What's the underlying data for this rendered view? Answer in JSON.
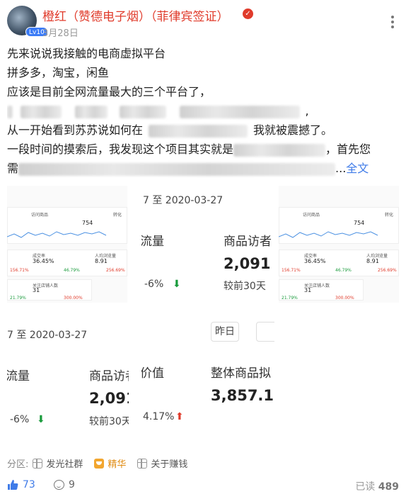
{
  "post": {
    "author": "橙红（赞德电子烟）（菲律宾签证）",
    "avatar_badge": "Lv10",
    "date": "3月28日",
    "lines": [
      "先来说说我接触的电商虚拟平台",
      "拼多多，淘宝，闲鱼",
      "应该是目前全网流量最大的三个平台了，"
    ],
    "line5_prefix": "从一开始看到苏苏说如何在",
    "line5_suffix": "我就被震撼了。",
    "line6_prefix": "一段时间的摸索后，我发现这个项目其实就是",
    "line6_suffix": "，首先您",
    "line7_prefix": "需",
    "ellipsis": "...",
    "full_text_link": "全文"
  },
  "images": {
    "date_range": "7 至 2020-03-27",
    "flow_label": "流量",
    "visit_label": "商品访者",
    "visit_value": "2,091",
    "compare_label": "较前30天",
    "flow_change": "-6%",
    "yesterday_btn": "昨日",
    "value_label": "价值",
    "overall_label": "整体商品拟",
    "overall_value": "3,857.1",
    "overall_change": "4.17%",
    "thumb": {
      "visit_title": "访问商品",
      "spark_value": "754",
      "conv_title": "转化",
      "rate_label": "成交率",
      "rate_value": "36.45%",
      "per_label": "人均浏览量",
      "per_value": "8.91",
      "fav_label": "关注店铺人数",
      "fav_value": "31",
      "red1": "156.71%",
      "green1": "46.79%",
      "red2": "256.69%",
      "green2": "21.79%",
      "red3": "300.00%"
    }
  },
  "tags": {
    "section_label": "分区:",
    "items": [
      "发光社群",
      "精华",
      "关于赚钱"
    ]
  },
  "footer": {
    "likes": "73",
    "comments": "9",
    "reads_label": "已读",
    "reads_value": "489"
  },
  "colors": {
    "author": "#e03b2b",
    "link": "#3f7be8",
    "essence": "#e08c13",
    "down": "#1a9b3c",
    "up": "#e03b2b"
  },
  "icons": [
    "more-icon",
    "verified-icon",
    "grid-icon",
    "essence-icon",
    "thumb-up-icon",
    "comment-icon"
  ]
}
